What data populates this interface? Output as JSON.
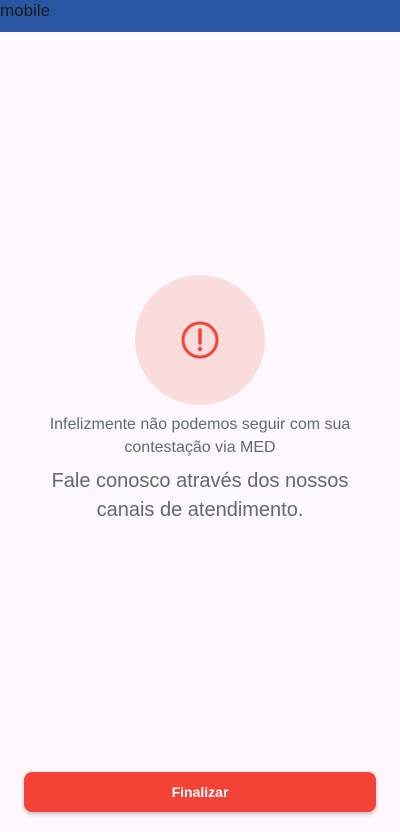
{
  "app_bar": {
    "title": "mobile"
  },
  "alert": {
    "icon": "alert-circle-icon",
    "accent_color": "#f44336",
    "background_color": "#fadcdc"
  },
  "messages": {
    "primary": "Infelizmente não podemos seguir com sua contestação via MED",
    "secondary": "Fale conosco através dos nossos canais de atendimento."
  },
  "actions": {
    "finish_label": "Finalizar",
    "finish_color": "#f44336"
  },
  "colors": {
    "app_bar": "#2a55a4",
    "page_background": "#fdf7fe",
    "text": "#5f6a74"
  }
}
